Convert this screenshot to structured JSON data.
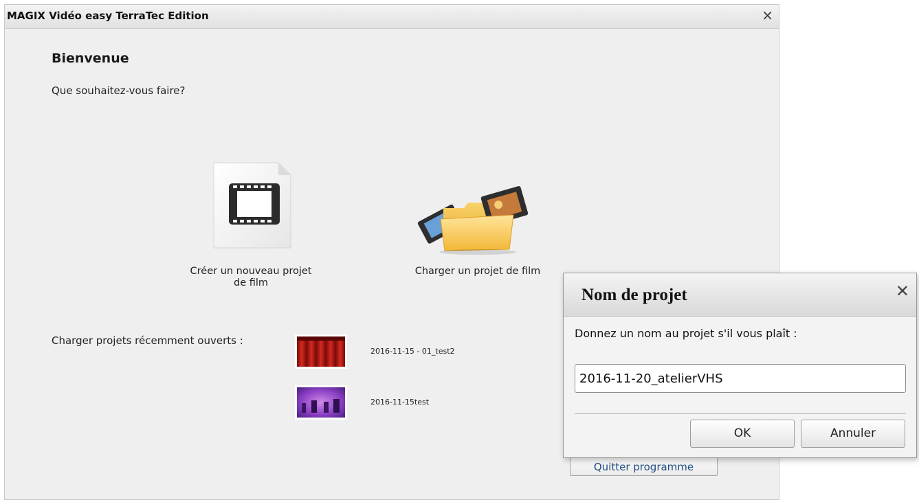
{
  "window": {
    "title": "MAGIX Vidéo easy TerraTec Edition",
    "close_glyph": "×"
  },
  "welcome": {
    "title": "Bienvenue",
    "question": "Que souhaitez-vous faire?"
  },
  "options": {
    "new_project": {
      "label_line1": "Créer un nouveau projet",
      "label_line2": "de film",
      "icon": "film-document-icon"
    },
    "load_project": {
      "label": "Charger un projet de film",
      "icon": "folder-film-icon"
    }
  },
  "recent": {
    "label": "Charger projets récemment ouverts :",
    "items": [
      {
        "name": "2016-11-15 - 01_test2",
        "thumb": "red-curtain-thumbnail"
      },
      {
        "name": "2016-11-15test",
        "thumb": "purple-stage-thumbnail"
      }
    ]
  },
  "quit": {
    "label": "Quitter programme"
  },
  "dialog": {
    "title": "Nom de projet",
    "close_glyph": "✕",
    "prompt": "Donnez un nom au projet s'il vous plaît :",
    "input_value": "2016-11-20_atelierVHS",
    "ok_label": "OK",
    "cancel_label": "Annuler"
  },
  "colors": {
    "quit_text": "#1f4e83",
    "window_bg": "#efefef"
  }
}
